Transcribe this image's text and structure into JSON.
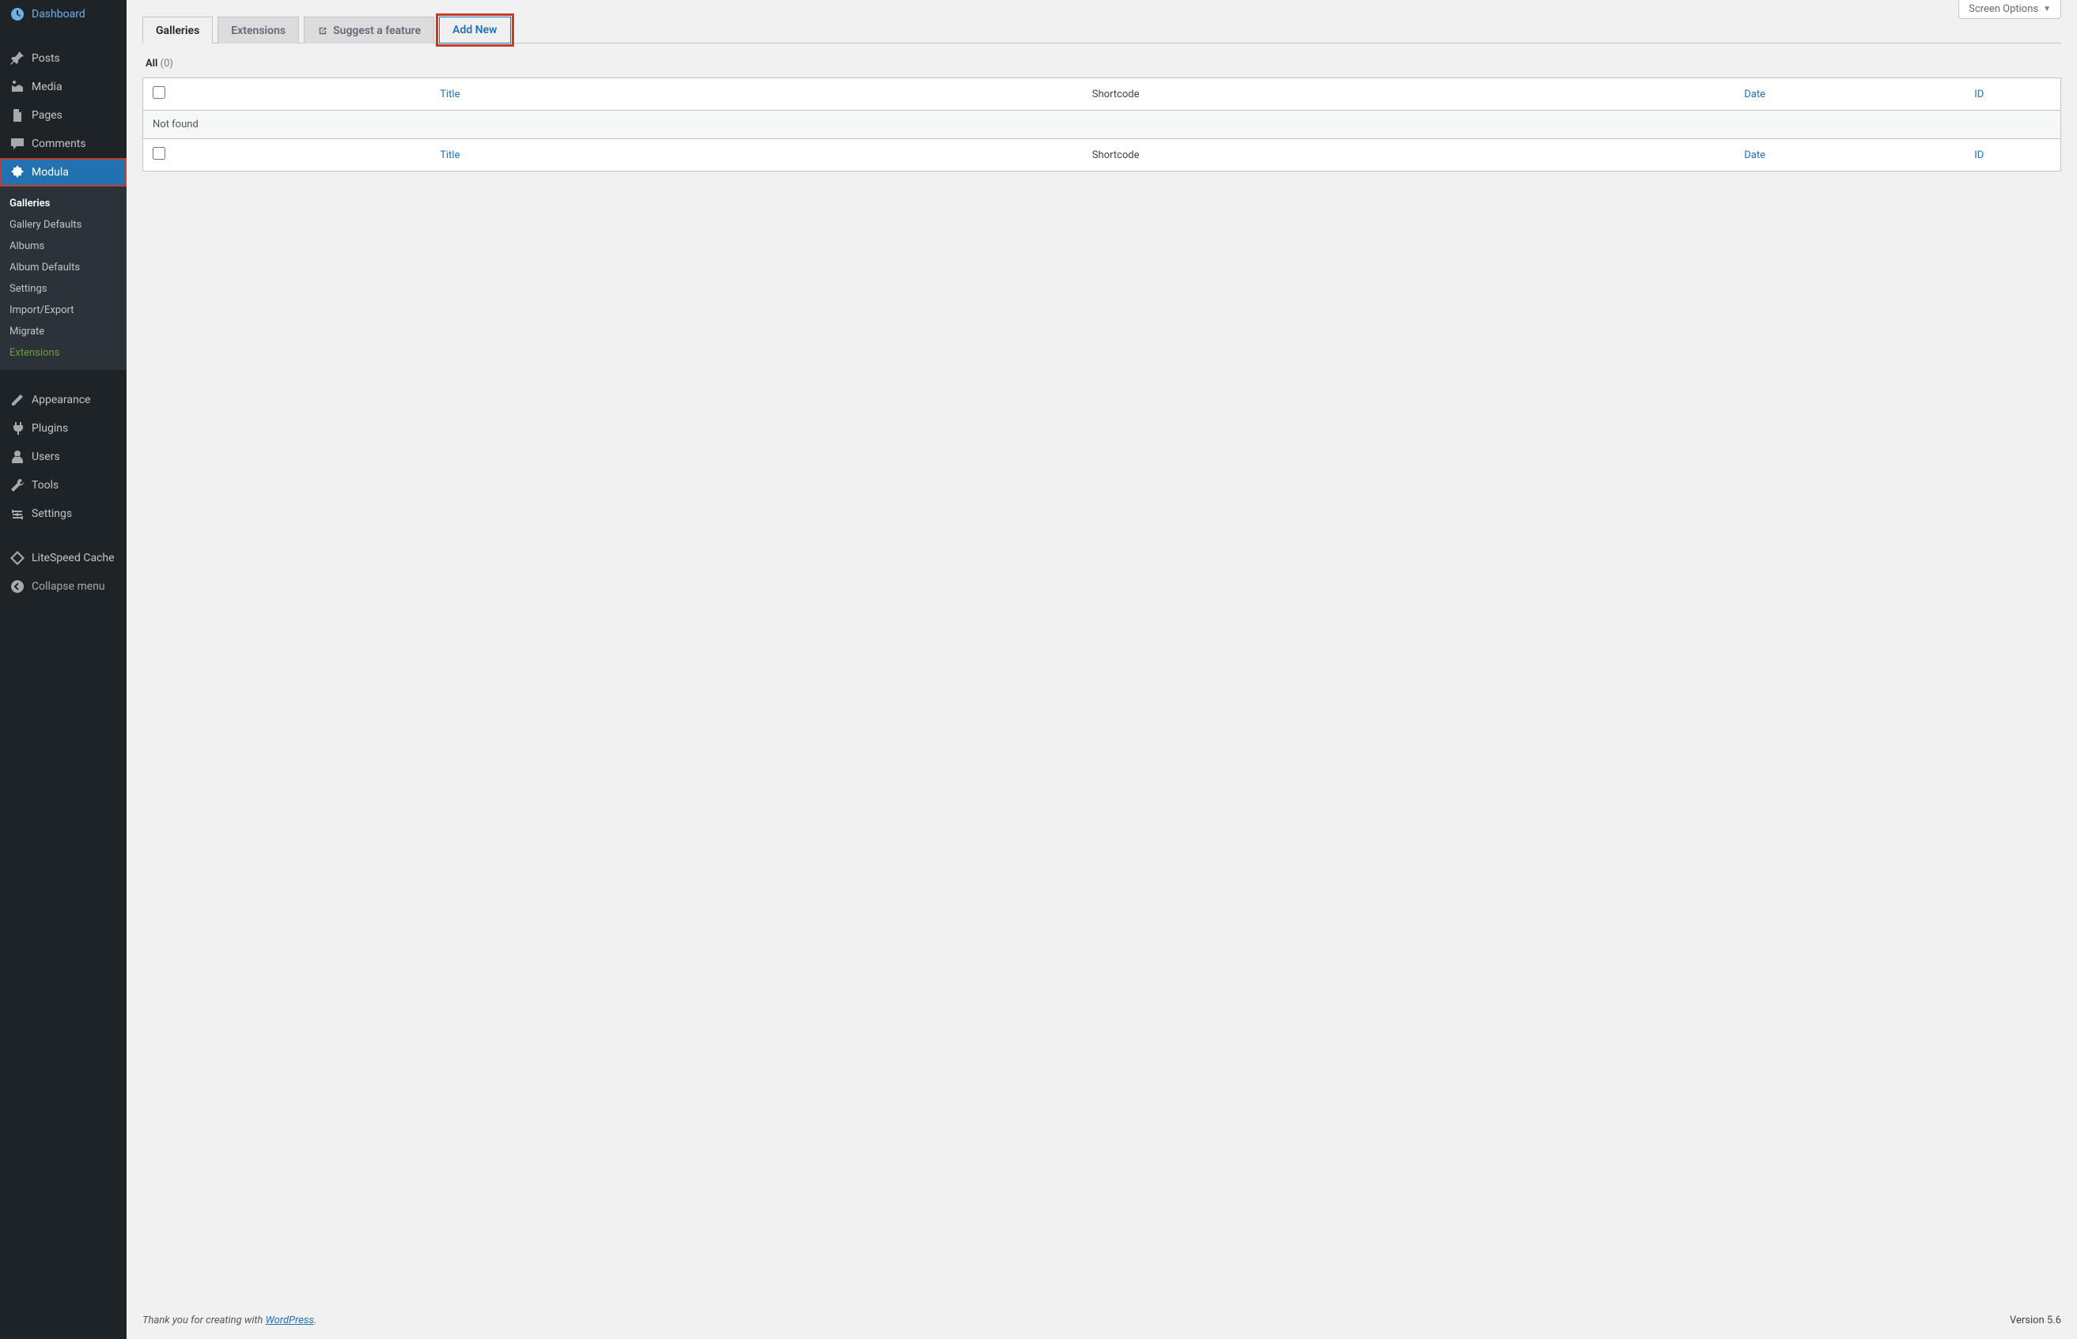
{
  "screen_options": "Screen Options",
  "sidebar": {
    "dashboard": "Dashboard",
    "posts": "Posts",
    "media": "Media",
    "pages": "Pages",
    "comments": "Comments",
    "modula": "Modula",
    "submenu": {
      "galleries": "Galleries",
      "gallery_defaults": "Gallery Defaults",
      "albums": "Albums",
      "album_defaults": "Album Defaults",
      "settings": "Settings",
      "import_export": "Import/Export",
      "migrate": "Migrate",
      "extensions": "Extensions"
    },
    "appearance": "Appearance",
    "plugins": "Plugins",
    "users": "Users",
    "tools": "Tools",
    "settings": "Settings",
    "litespeed": "LiteSpeed Cache",
    "collapse": "Collapse menu"
  },
  "tabs": {
    "galleries": "Galleries",
    "extensions": "Extensions",
    "suggest": "Suggest a feature",
    "add_new": "Add New"
  },
  "filter": {
    "all": "All",
    "count": "(0)"
  },
  "table": {
    "title": "Title",
    "shortcode": "Shortcode",
    "date": "Date",
    "id": "ID",
    "not_found": "Not found"
  },
  "footer": {
    "thanks_pre": "Thank you for creating with ",
    "wp": "WordPress",
    "dot": ".",
    "version": "Version 5.6"
  }
}
